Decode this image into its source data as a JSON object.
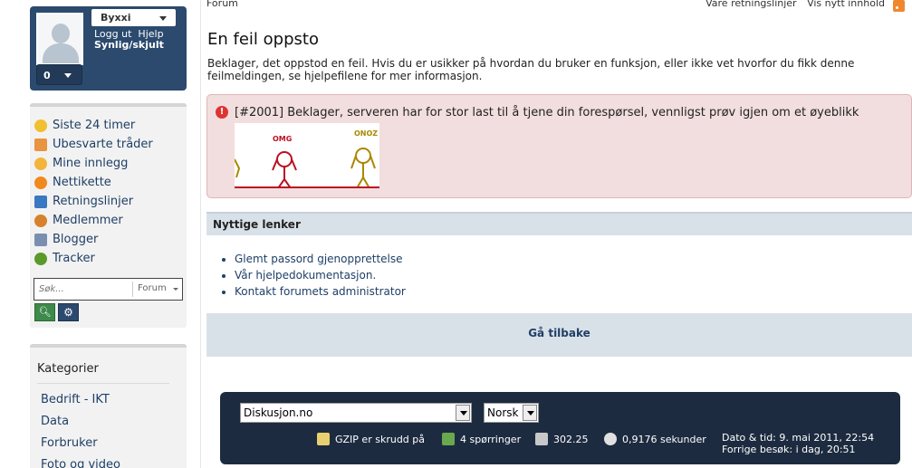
{
  "user": {
    "name": "Byxxi",
    "logout_label": "Logg ut",
    "help_label": "Hjelp",
    "visibility_label": "Synlig/skjult",
    "count": "0"
  },
  "sidebar": {
    "items": [
      {
        "label": "Siste 24 timer",
        "icon": "clock-icon",
        "color": "#f0c030"
      },
      {
        "label": "Ubesvarte tråder",
        "icon": "mail-icon",
        "color": "#e89440"
      },
      {
        "label": "Mine innlegg",
        "icon": "smiley-icon",
        "color": "#f2b43a"
      },
      {
        "label": "Nettikette",
        "icon": "warning-icon",
        "color": "#f08a1c"
      },
      {
        "label": "Retningslinjer",
        "icon": "accessibility-icon",
        "color": "#3a78c2"
      },
      {
        "label": "Medlemmer",
        "icon": "members-icon",
        "color": "#d8812c"
      },
      {
        "label": "Blogger",
        "icon": "blog-icon",
        "color": "#7a8fb0"
      },
      {
        "label": "Tracker",
        "icon": "bug-icon",
        "color": "#5a9a2a"
      }
    ],
    "search_placeholder": "Søk...",
    "search_scope": "Forum",
    "categories_title": "Kategorier",
    "categories": [
      "Bedrift - IKT",
      "Data",
      "Forbruker",
      "Foto og video"
    ]
  },
  "topbar": {
    "breadcrumb": "Forum",
    "guidelines": "Våre retningslinjer",
    "new_content": "Vis nytt innhold"
  },
  "main": {
    "title": "En feil oppsto",
    "description": "Beklager, det oppstod en feil. Hvis du er usikker på hvordan du bruker en funksjon, eller ikke vet hvorfor du fikk denne feilmeldingen, se hjelpefilene for mer informasjon.",
    "error_message": "[#2001] Beklager, serveren har for stor last til å tjene din forespørsel, vennligst prøv igjen om et øyeblikk",
    "image_labels": [
      "OMG",
      "ONOZ"
    ],
    "links_title": "Nyttige lenker",
    "links": [
      "Glemt passord gjenopprettelse",
      "Vår hjelpedokumentasjon.",
      "Kontakt forumets administrator"
    ],
    "back_label": "Gå tilbake"
  },
  "footer": {
    "skin_select": "Diskusjon.no",
    "language_select": "Norsk",
    "gzip": "GZIP er skrudd på",
    "queries": "4 spørringer",
    "memory": "302.25",
    "time_taken": "0,9176 sekunder",
    "datetime": "Dato & tid: 9. mai 2011, 22:54",
    "last_visit": "Forrige besøk: i dag, 20:51"
  }
}
